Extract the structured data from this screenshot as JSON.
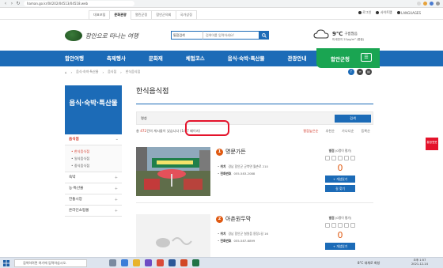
{
  "browser": {
    "url": "haman.go.kr/04202/04513/04518.web"
  },
  "util_bar": {
    "tabs": [
      "대표포털",
      "문화관광",
      "열린군정",
      "함안군의회",
      "국가상징"
    ],
    "active_tab": "문화관광",
    "right_links": [
      "로그인",
      "사이트맵",
      "LANGUAGES"
    ]
  },
  "header": {
    "logo_text": "함안으로 떠나는 여행",
    "search_select": "통합검색",
    "search_placeholder": "검색어를 입력하세요!",
    "weather_temp": "9℃",
    "weather_cond": "구름많음",
    "weather_dust": "미세먼지 22µg/m³ (좋음)"
  },
  "main_nav": {
    "items": [
      "함안여행",
      "축제행사",
      "문화재",
      "체험코스",
      "음식·숙박·특산물",
      "관광안내"
    ],
    "green_label": "함안군청"
  },
  "breadcrumb": [
    "음식·숙박·특산물",
    "음식점",
    "한식음식점"
  ],
  "sidebar": {
    "title": "음식·숙박·특산물",
    "items": [
      {
        "label": "음식점",
        "active": true
      },
      {
        "label": "숙박",
        "active": false
      },
      {
        "label": "농·특산물",
        "active": false
      },
      {
        "label": "전통시장",
        "active": false
      },
      {
        "label": "온라인쇼핑몰",
        "active": false
      }
    ],
    "sub_items": [
      "한식음식점",
      "일식음식점",
      "중식음식점"
    ],
    "active_sub": "한식음식점"
  },
  "content": {
    "title": "한식음식점",
    "filter_label": "명칭",
    "filter_button": "검색",
    "count_prefix": "총 ",
    "count_num": "472",
    "count_text": "건의 게시물이 있습니다 (1/47 페이지)",
    "sort_options": [
      "평점높은순",
      "추천순",
      "가나다순",
      "등록순"
    ],
    "active_sort": "평점높은순",
    "items": [
      {
        "rank": "1",
        "name": "명문가든",
        "location_label": "위치",
        "location": "경남 함안군 군북면 월촌로 210",
        "phone_label": "전화번호",
        "phone": "055-583-2088",
        "rating_label": "별점",
        "rating_sub": "(0명이 평가)",
        "likes": "0",
        "like_button": "+ 개념있기",
        "map_button": "길 찾기"
      },
      {
        "rank": "2",
        "name": "아촌원두막",
        "location_label": "위치",
        "location": "경남 함안군 칠원읍 용정1길 16",
        "phone_label": "전화번호",
        "phone": "055-587-6899",
        "rating_label": "별점",
        "rating_sub": "(0명이 평가)",
        "likes": "0",
        "like_button": "+ 개념있기",
        "map_button": ""
      }
    ]
  },
  "float_right": "통합챗봇",
  "taskbar": {
    "search_placeholder": "검색하려면 여기에 입력하십시오.",
    "tray_temp": "8°C 대체로 화창",
    "time": "오후 1:57",
    "date": "2021-12-14"
  },
  "colors": {
    "brand_blue": "#1c6bb7",
    "green": "#1aa552",
    "accent_red": "#d23a2b",
    "annotation_red": "#e4132b"
  }
}
